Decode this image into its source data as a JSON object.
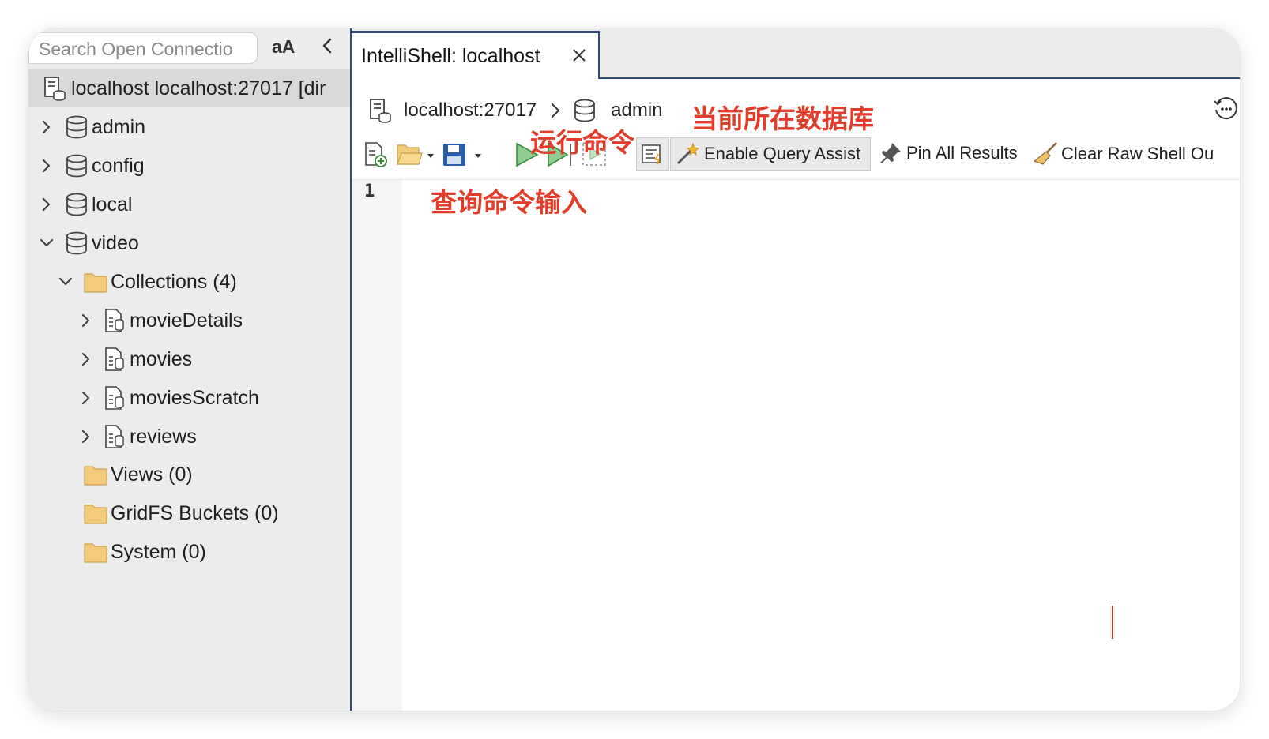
{
  "sidebar": {
    "search_placeholder": "Search Open Connectio",
    "font_toggle": "aA",
    "connection_label": "localhost localhost:27017 [dir",
    "databases": [
      {
        "label": "admin"
      },
      {
        "label": "config"
      },
      {
        "label": "local"
      },
      {
        "label": "video"
      }
    ],
    "collections_folder": "Collections (4)",
    "collections": [
      {
        "label": "movieDetails"
      },
      {
        "label": "movies"
      },
      {
        "label": "moviesScratch"
      },
      {
        "label": "reviews"
      }
    ],
    "views_folder": "Views (0)",
    "gridfs_folder": "GridFS Buckets (0)",
    "system_folder": "System (0)"
  },
  "tab": {
    "label": "IntelliShell: localhost"
  },
  "breadcrumb": {
    "host": "localhost:27017",
    "database": "admin"
  },
  "toolbar": {
    "enable_query_assist": "Enable Query Assist",
    "pin_all_results": "Pin All Results",
    "clear_raw_shell": "Clear Raw Shell Ou"
  },
  "editor": {
    "line_number": "1"
  },
  "annotations": {
    "current_db": "当前所在数据库",
    "run_command": "运行命令",
    "query_input": "查询命令输入"
  },
  "colors": {
    "annotation": "#e23c2b",
    "accent": "#2d4b74",
    "run_green": "#6bb36b",
    "folder": "#f2cc7a"
  }
}
